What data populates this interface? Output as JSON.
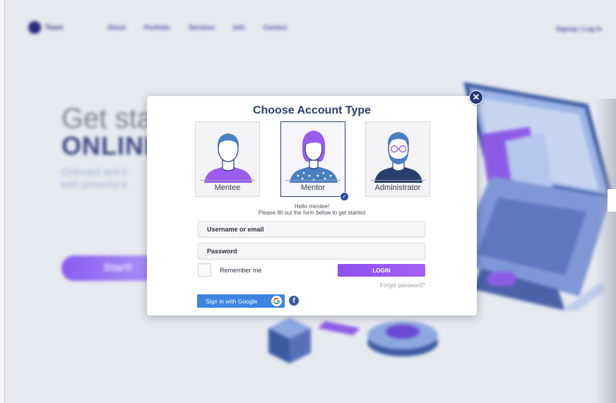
{
  "background": {
    "logo_text": "Team",
    "nav_links": [
      "About",
      "Portfolio",
      "Services",
      "Info",
      "Contact"
    ],
    "signup_link": "Signup / Log in",
    "hero_title_line1": "Get sta",
    "hero_title_line2": "ONLINI",
    "hero_subtitle_line1": "Onboard and tr",
    "hero_subtitle_line2": "with powerful e",
    "start_button": "Start!"
  },
  "modal": {
    "title": "Choose Account Type",
    "close_symbol": "✕",
    "account_types": [
      {
        "label": "Mentee",
        "selected": false,
        "icon": "mentee-avatar-icon"
      },
      {
        "label": "Mentor",
        "selected": true,
        "icon": "mentor-avatar-icon"
      },
      {
        "label": "Administrator",
        "selected": false,
        "icon": "administrator-avatar-icon"
      }
    ],
    "greeting_line1": "Hello mentee!",
    "greeting_line2": "Please fill out the form below to get started",
    "username_placeholder": "Username or email",
    "password_placeholder": "Password",
    "remember_me": "Remember me",
    "login_button": "LOGIN",
    "forgot_password": "Forgot password?",
    "google_button": "Sign in with Google",
    "facebook_icon": "f"
  },
  "colors": {
    "title": "#2a3e6e",
    "login_gradient_start": "#8f4ff0",
    "login_gradient_end": "#a560f2",
    "google_blue": "#3d85e0",
    "facebook_blue": "#3b5a9a",
    "avatar_purple": "#9b5cf0",
    "avatar_blue": "#4a7fc0"
  }
}
